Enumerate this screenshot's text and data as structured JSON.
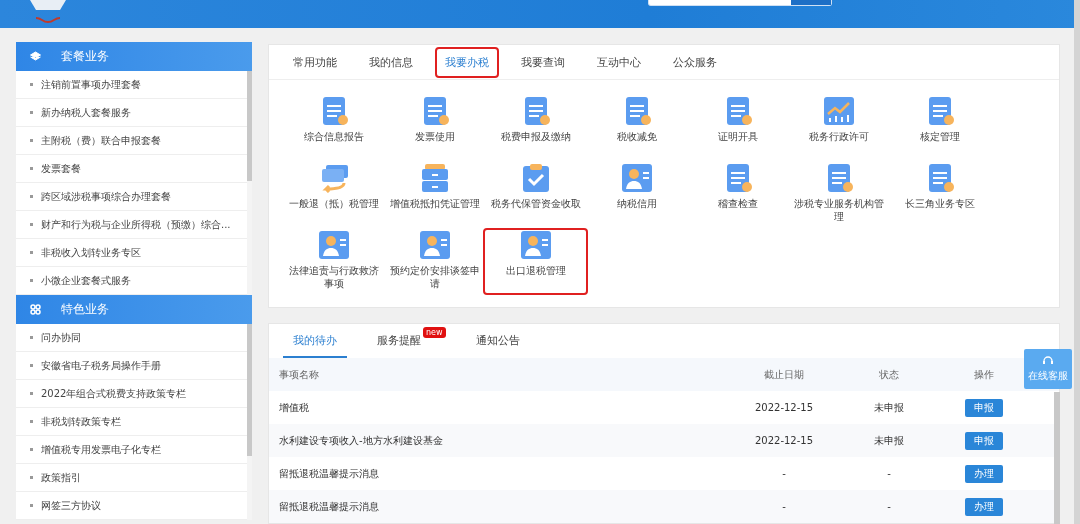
{
  "sidebar": {
    "sections": [
      {
        "title": "套餐业务",
        "items": [
          "注销前置事项办理套餐",
          "新办纳税人套餐服务",
          "主附税（费）联合申报套餐",
          "发票套餐",
          "跨区域涉税事项综合办理套餐",
          "财产和行为税与企业所得税（预缴）综合...",
          "非税收入划转业务专区",
          "小微企业套餐式服务"
        ]
      },
      {
        "title": "特色业务",
        "items": [
          "问办协同",
          "安徽省电子税务局操作手册",
          "2022年组合式税费支持政策专栏",
          "非税划转政策专栏",
          "增值税专用发票电子化专栏",
          "政策指引",
          "网签三方协议"
        ]
      }
    ]
  },
  "function_tabs": [
    {
      "label": "常用功能",
      "selected": false,
      "highlighted": false
    },
    {
      "label": "我的信息",
      "selected": false,
      "highlighted": false
    },
    {
      "label": "我要办税",
      "selected": true,
      "highlighted": true
    },
    {
      "label": "我要查询",
      "selected": false,
      "highlighted": false
    },
    {
      "label": "互动中心",
      "selected": false,
      "highlighted": false
    },
    {
      "label": "公众服务",
      "selected": false,
      "highlighted": false
    }
  ],
  "functions": [
    {
      "label": "综合信息报告",
      "highlighted": false
    },
    {
      "label": "发票使用",
      "highlighted": false
    },
    {
      "label": "税费申报及缴纳",
      "highlighted": false
    },
    {
      "label": "税收减免",
      "highlighted": false
    },
    {
      "label": "证明开具",
      "highlighted": false
    },
    {
      "label": "税务行政许可",
      "highlighted": false
    },
    {
      "label": "核定管理",
      "highlighted": false
    },
    {
      "label": "一般退（抵）税管理",
      "highlighted": false
    },
    {
      "label": "增值税抵扣凭证管理",
      "highlighted": false
    },
    {
      "label": "税务代保管资金收取",
      "highlighted": false
    },
    {
      "label": "纳税信用",
      "highlighted": false
    },
    {
      "label": "稽查检查",
      "highlighted": false
    },
    {
      "label": "涉税专业服务机构管理",
      "highlighted": false
    },
    {
      "label": "长三角业务专区",
      "highlighted": false
    },
    {
      "label": "法律追责与行政救济事项",
      "highlighted": false
    },
    {
      "label": "预约定价安排谈签申请",
      "highlighted": false
    },
    {
      "label": "出口退税管理",
      "highlighted": true
    }
  ],
  "todo_tabs": [
    {
      "label": "我的待办",
      "selected": true
    },
    {
      "label": "服务提醒",
      "selected": false,
      "badge": "new"
    },
    {
      "label": "通知公告",
      "selected": false
    }
  ],
  "table": {
    "columns": [
      "事项名称",
      "截止日期",
      "状态",
      "操作"
    ],
    "rows": [
      {
        "name": "增值税",
        "deadline": "2022-12-15",
        "status": "未申报",
        "action": "申报"
      },
      {
        "name": "水利建设专项收入-地方水利建设基金",
        "deadline": "2022-12-15",
        "status": "未申报",
        "action": "申报"
      },
      {
        "name": "留抵退税温馨提示消息",
        "deadline": "-",
        "status": "-",
        "action": "办理"
      },
      {
        "name": "留抵退税温馨提示消息",
        "deadline": "-",
        "status": "-",
        "action": "办理"
      }
    ]
  },
  "service_button": "在线客服"
}
